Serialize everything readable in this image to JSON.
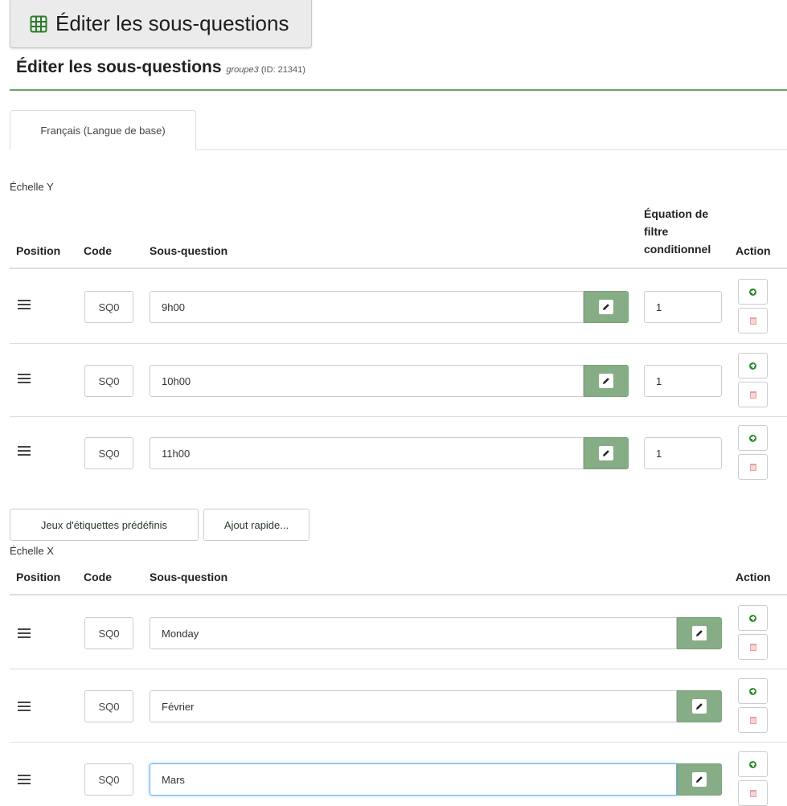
{
  "top_button": {
    "label": "Éditer les sous-questions",
    "icon": "table-grid-icon"
  },
  "section": {
    "title": "Éditer les sous-questions",
    "group": "groupe3",
    "id": "(ID: 21341)"
  },
  "tab": {
    "label": "Français (Langue de base)"
  },
  "scale_y": {
    "label": "Échelle Y",
    "headers": {
      "position": "Position",
      "code": "Code",
      "subquestion": "Sous-question",
      "filter_l1": "Équation de",
      "filter_l2": "filtre",
      "filter_l3": "conditionnel",
      "action": "Action"
    },
    "rows": [
      {
        "code": "SQ0",
        "text": "9h00",
        "filter": "1"
      },
      {
        "code": "SQ0",
        "text": "10h00",
        "filter": "1"
      },
      {
        "code": "SQ0",
        "text": "11h00",
        "filter": "1"
      }
    ]
  },
  "buttons": {
    "predefined": "Jeux d'étiquettes prédéfinis",
    "quick_add": "Ajout rapide..."
  },
  "scale_x": {
    "label": "Échelle X",
    "headers": {
      "position": "Position",
      "code": "Code",
      "subquestion": "Sous-question",
      "action": "Action"
    },
    "rows": [
      {
        "code": "SQ0",
        "text": "Monday"
      },
      {
        "code": "SQ0",
        "text": "Février"
      },
      {
        "code": "SQ0",
        "text": "Mars"
      }
    ]
  },
  "colors": {
    "accent_green": "#6aa36b",
    "edit_button": "#87ad86",
    "add_icon": "#2f8f2f",
    "focus_border": "#66afe9"
  }
}
